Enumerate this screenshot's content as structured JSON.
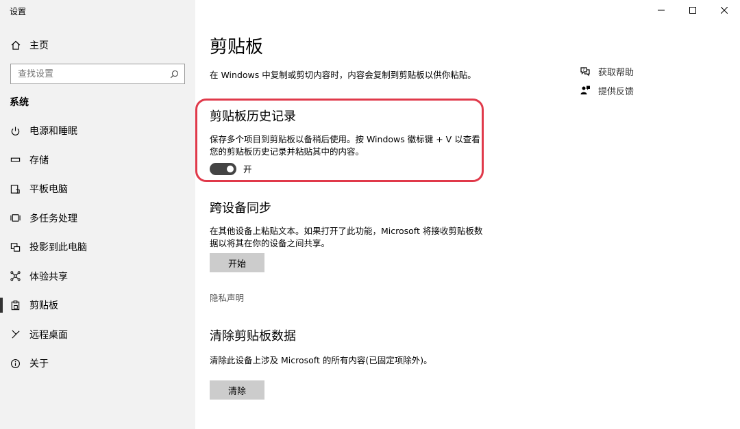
{
  "window": {
    "title": "设置"
  },
  "sidebar": {
    "home_label": "主页",
    "search_placeholder": "查找设置",
    "section": "系统",
    "items": [
      {
        "label": "电源和睡眠",
        "icon": "power-icon"
      },
      {
        "label": "存储",
        "icon": "storage-icon"
      },
      {
        "label": "平板电脑",
        "icon": "tablet-icon"
      },
      {
        "label": "多任务处理",
        "icon": "multitasking-icon"
      },
      {
        "label": "投影到此电脑",
        "icon": "project-icon"
      },
      {
        "label": "体验共享",
        "icon": "shared-experiences-icon"
      },
      {
        "label": "剪贴板",
        "icon": "clipboard-icon",
        "active": true
      },
      {
        "label": "远程桌面",
        "icon": "remote-desktop-icon"
      },
      {
        "label": "关于",
        "icon": "info-icon"
      }
    ]
  },
  "main": {
    "title": "剪贴板",
    "description": "在 Windows 中复制或剪切内容时，内容会复制到剪贴板以供你粘贴。",
    "history": {
      "heading": "剪贴板历史记录",
      "text_line1": "保存多个项目到剪贴板以备稍后使用。按 Windows 徽标键 + V 以查看",
      "text_line2": "您的剪贴板历史记录并粘贴其中的内容。",
      "toggle_state": "开"
    },
    "sync": {
      "heading": "跨设备同步",
      "text_line1": "在其他设备上粘贴文本。如果打开了此功能，Microsoft 将接收剪贴板数",
      "text_line2": "据以将其在你的设备之间共享。",
      "button": "开始",
      "privacy_link": "隐私声明"
    },
    "clear": {
      "heading": "清除剪贴板数据",
      "text": "清除此设备上涉及 Microsoft 的所有内容(已固定项除外)。",
      "button": "清除"
    },
    "help": {
      "get_help": "获取帮助",
      "feedback": "提供反馈"
    }
  },
  "colors": {
    "highlight": "#e0394a",
    "sidebar_bg": "#f2f2f2",
    "button_bg": "#cccccc"
  }
}
